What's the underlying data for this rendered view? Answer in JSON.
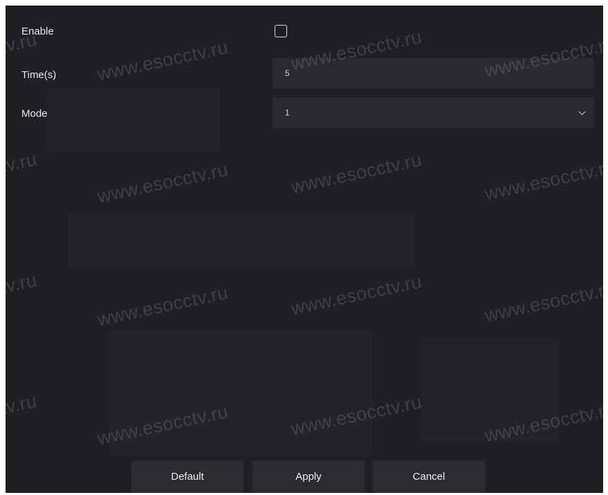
{
  "form": {
    "enable": {
      "label": "Enable",
      "checked": false
    },
    "time": {
      "label": "Time(s)",
      "value": "5"
    },
    "mode": {
      "label": "Mode",
      "value": "1"
    }
  },
  "buttons": {
    "default_label": "Default",
    "apply_label": "Apply",
    "cancel_label": "Cancel"
  },
  "watermark": {
    "text": "www.esocctv.ru",
    "fragment": "tv.ru"
  },
  "colors": {
    "panel_bg": "#1f2024",
    "field_bg": "#2a2b2f",
    "button_bg": "#2b2c30",
    "text": "#eaeaea"
  },
  "icons": {
    "dropdown": "chevron-down-icon"
  }
}
